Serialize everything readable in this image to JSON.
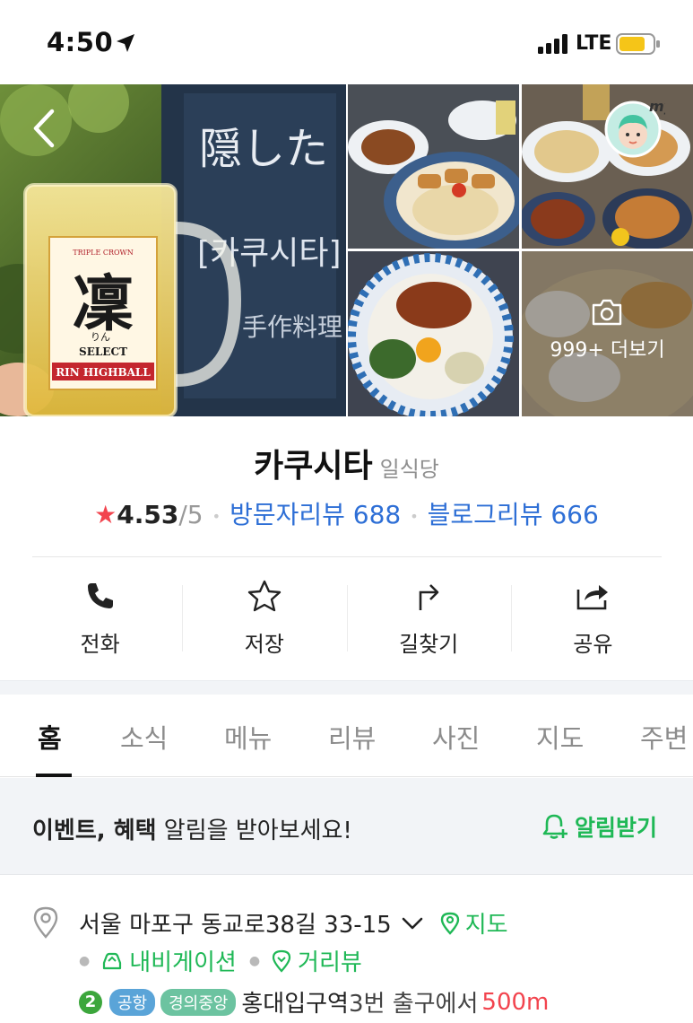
{
  "status_bar": {
    "time": "4:50",
    "network": "LTE"
  },
  "gallery": {
    "main_glass_logo": "凜",
    "main_glass_select": "SELECT",
    "main_glass_brand": "RIN HIGHBALL",
    "main_glass_crown": "TRIPLE CROWN",
    "main_glass_reading": "りん",
    "sign_line1": "隠した",
    "sign_line2": "[카쿠시타]",
    "sign_line3": "手作料理",
    "more_label": "999+ 더보기",
    "avatar_badge": "my"
  },
  "place": {
    "name": "카쿠시타",
    "category": "일식당",
    "rating": "4.53",
    "rating_max": "/5",
    "visitor_reviews": "방문자리뷰 688",
    "blog_reviews": "블로그리뷰 666"
  },
  "actions": {
    "call": "전화",
    "save": "저장",
    "directions": "길찾기",
    "share": "공유"
  },
  "tabs": {
    "home": "홈",
    "news": "소식",
    "menu": "메뉴",
    "review": "리뷰",
    "photo": "사진",
    "map": "지도",
    "nearby": "주변"
  },
  "notify": {
    "bold_part": "이벤트, 혜택",
    "rest": " 알림을 받아보세요!",
    "button": "알림받기"
  },
  "address": {
    "text": "서울 마포구 동교로38길 33-15",
    "map_link": "지도",
    "navigation_link": "내비게이션",
    "street_view_link": "거리뷰",
    "line_number": "2",
    "badge_airport": "공항",
    "badge_gyeongui": "경의중앙",
    "station": "홍대입구역",
    "exit_info": " 3번 출구에서 ",
    "distance": "500m"
  },
  "colors": {
    "green": "#1fb856",
    "blue_link": "#2e6fd6",
    "star_red": "#f2444e"
  }
}
